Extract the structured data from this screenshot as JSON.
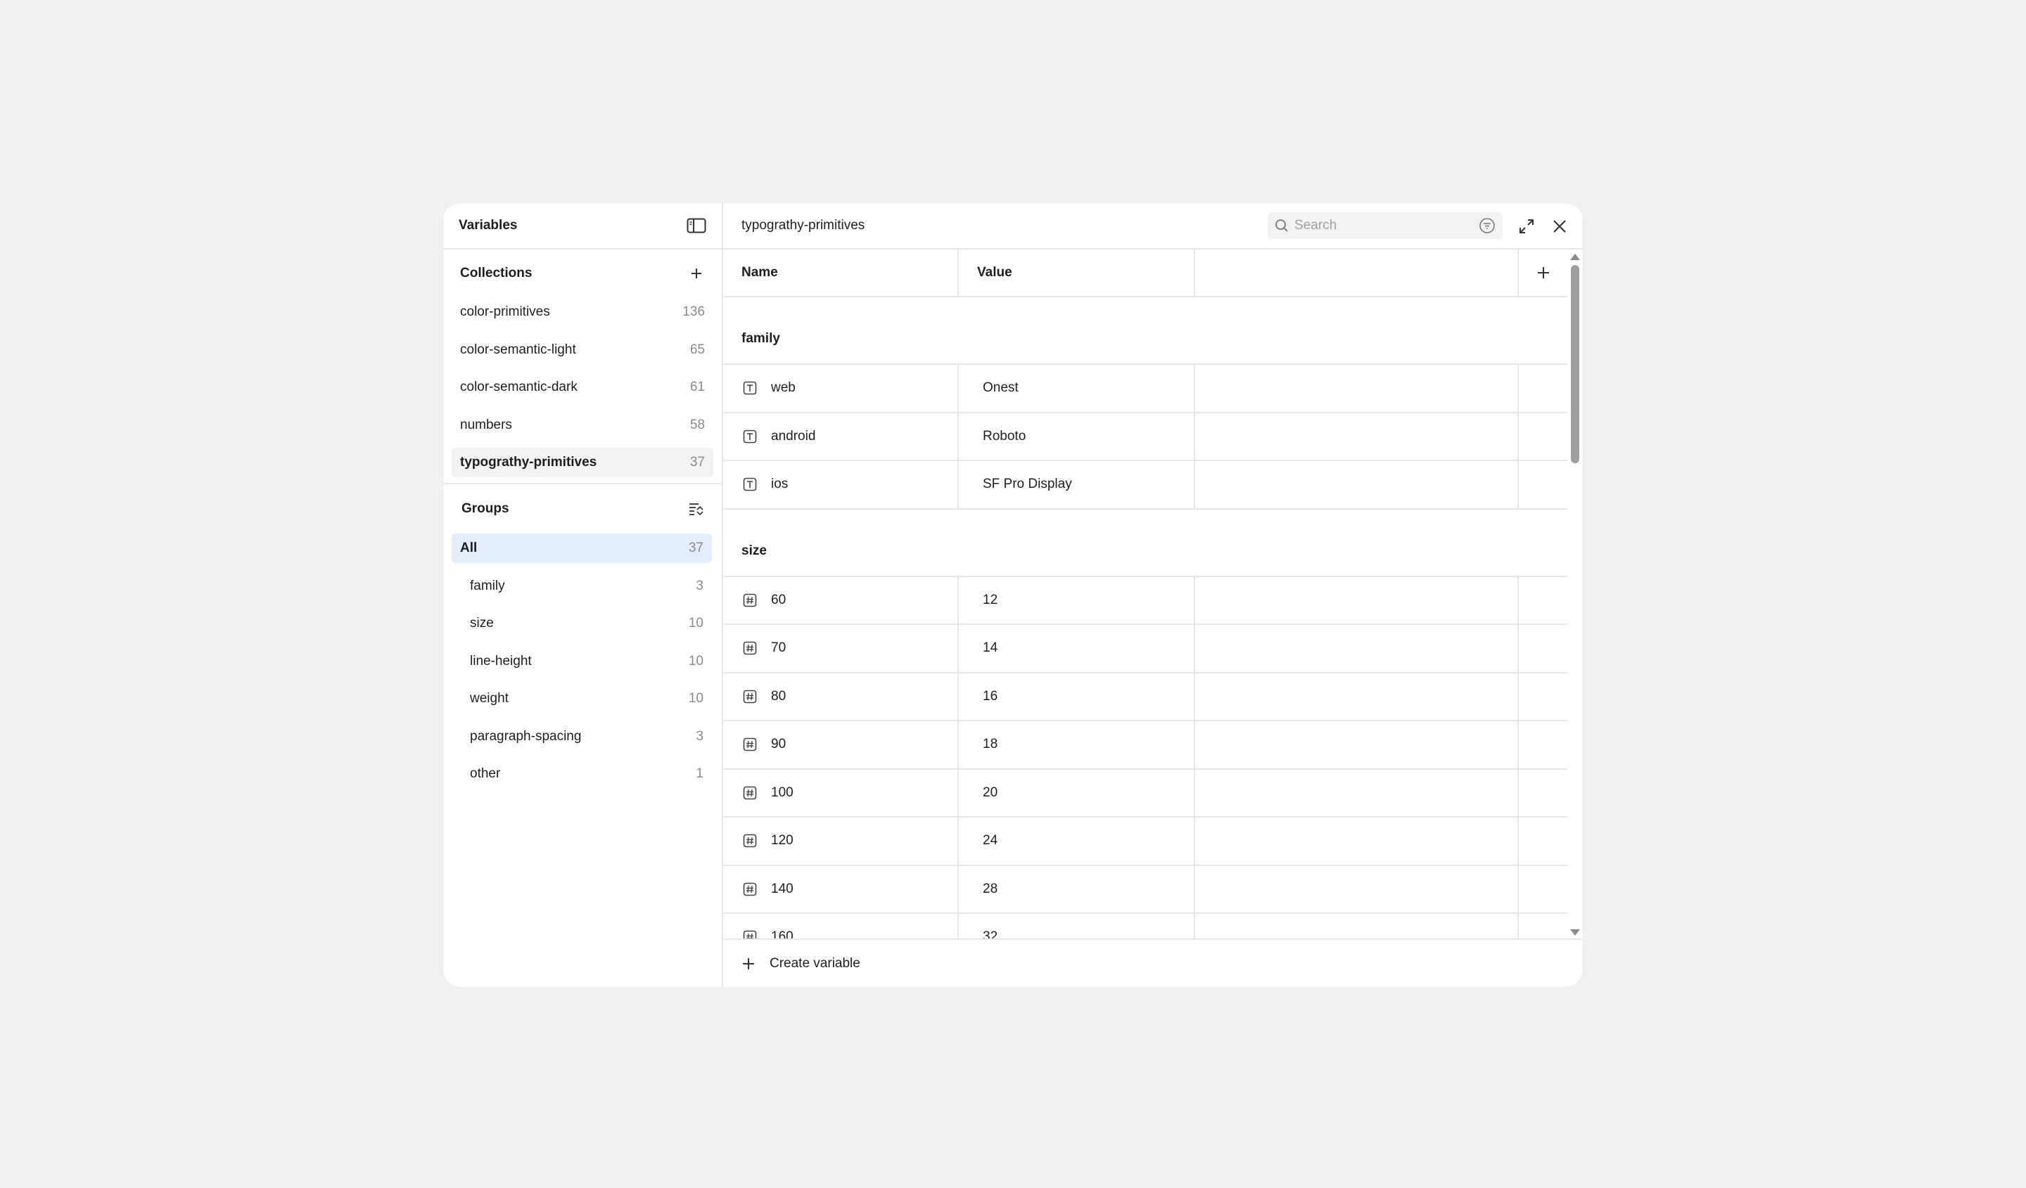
{
  "sidebar": {
    "title": "Variables",
    "collections_title": "Collections",
    "collections": [
      {
        "label": "color-primitives",
        "count": "136"
      },
      {
        "label": "color-semantic-light",
        "count": "65"
      },
      {
        "label": "color-semantic-dark",
        "count": "61"
      },
      {
        "label": "numbers",
        "count": "58"
      },
      {
        "label": "typograthy-primitives",
        "count": "37"
      }
    ],
    "groups_title": "Groups",
    "groups": [
      {
        "label": "All",
        "count": "37"
      },
      {
        "label": "family",
        "count": "3"
      },
      {
        "label": "size",
        "count": "10"
      },
      {
        "label": "line-height",
        "count": "10"
      },
      {
        "label": "weight",
        "count": "10"
      },
      {
        "label": "paragraph-spacing",
        "count": "3"
      },
      {
        "label": "other",
        "count": "1"
      }
    ]
  },
  "main": {
    "title": "typograthy-primitives",
    "search_placeholder": "Search",
    "columns": {
      "name": "Name",
      "value": "Value"
    },
    "groups": [
      {
        "title": "family",
        "rows": [
          {
            "name": "web",
            "value": "Onest"
          },
          {
            "name": "android",
            "value": "Roboto"
          },
          {
            "name": "ios",
            "value": "SF Pro Display"
          }
        ]
      },
      {
        "title": "size",
        "rows": [
          {
            "name": "60",
            "value": "12"
          },
          {
            "name": "70",
            "value": "14"
          },
          {
            "name": "80",
            "value": "16"
          },
          {
            "name": "90",
            "value": "18"
          },
          {
            "name": "100",
            "value": "20"
          },
          {
            "name": "120",
            "value": "24"
          },
          {
            "name": "140",
            "value": "28"
          },
          {
            "name": "160",
            "value": "32"
          }
        ]
      }
    ],
    "create_label": "Create variable"
  }
}
